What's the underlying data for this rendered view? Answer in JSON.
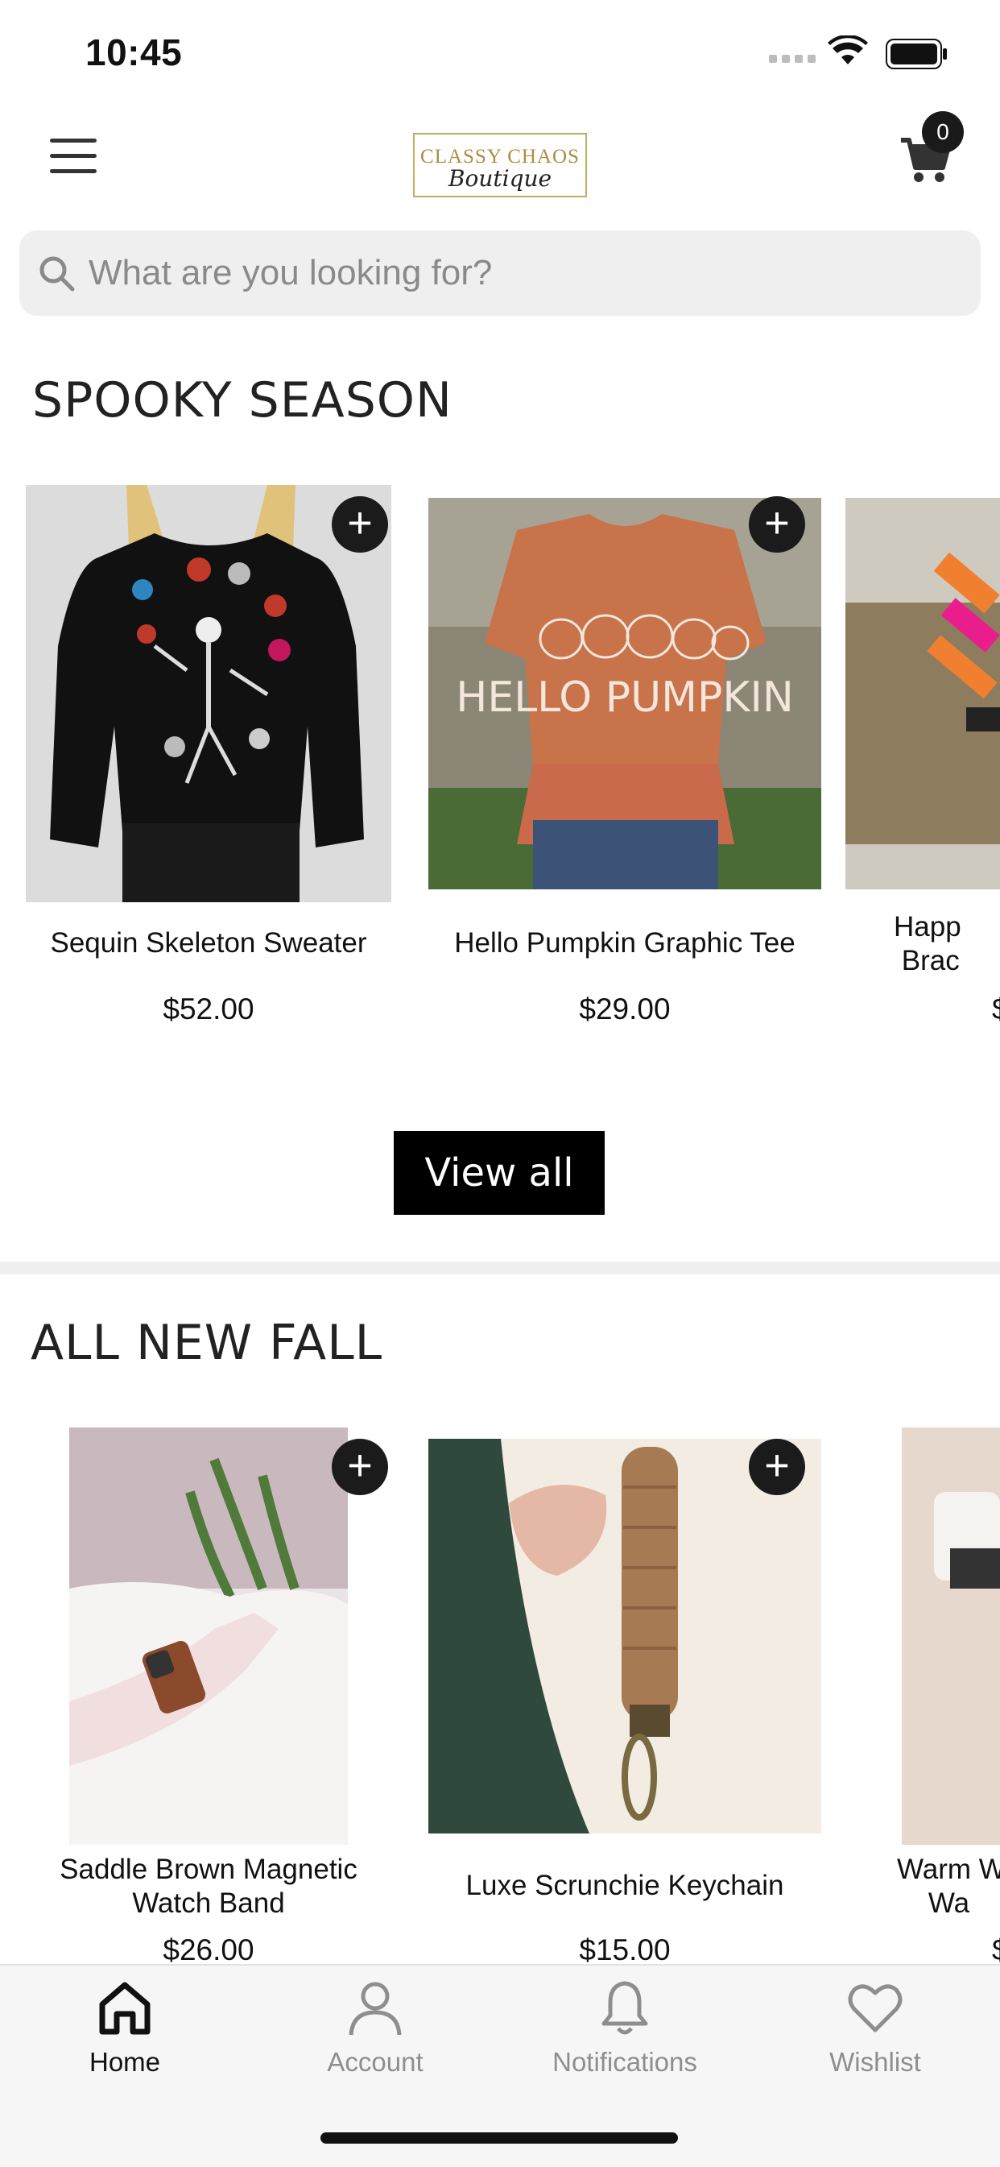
{
  "status_bar": {
    "time": "10:45",
    "battery_icon": "battery-icon",
    "wifi_icon": "wifi-icon"
  },
  "header": {
    "menu_icon": "hamburger-menu-icon",
    "logo_text_top": "CLASSY CHAOS",
    "logo_text_script": "Boutique",
    "cart_count": "0",
    "cart_icon": "cart-icon"
  },
  "search": {
    "placeholder": "What are you looking for?",
    "icon": "search-icon"
  },
  "sections": [
    {
      "title": "SPOOKY SEASON",
      "products": [
        {
          "name": "Sequin Skeleton Sweater",
          "price": "$52.00"
        },
        {
          "name": "Hello Pumpkin Graphic Tee",
          "price": "$29.00",
          "image_text": "HELLO PUMPKIN"
        },
        {
          "name": "Happy Bracelet",
          "name_visible": "Happ Brac",
          "price": "$"
        }
      ],
      "view_all_label": "View all"
    },
    {
      "title": "ALL NEW FALL",
      "products": [
        {
          "name": "Saddle Brown Magnetic Watch Band",
          "price": "$26.00"
        },
        {
          "name": "Luxe Scrunchie Keychain",
          "price": "$15.00"
        },
        {
          "name": "Warm W Wa",
          "price": "$"
        }
      ]
    }
  ],
  "tab_bar": {
    "tabs": [
      {
        "label": "Home",
        "icon": "home-icon",
        "active": true
      },
      {
        "label": "Account",
        "icon": "account-icon",
        "active": false
      },
      {
        "label": "Notifications",
        "icon": "bell-icon",
        "active": false
      },
      {
        "label": "Wishlist",
        "icon": "heart-icon",
        "active": false
      }
    ]
  },
  "colors": {
    "accent": "#000000",
    "inactive_tab": "#8e8e8e",
    "logo_gold": "#b08a3e",
    "search_bg": "#efefef"
  }
}
